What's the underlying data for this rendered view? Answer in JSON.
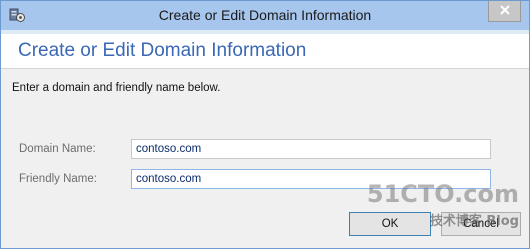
{
  "window": {
    "title": "Create or Edit Domain Information",
    "app_icon": "server-manager-icon",
    "close_icon": "close-icon"
  },
  "header": {
    "title": "Create or Edit Domain Information"
  },
  "content": {
    "instruction": "Enter a domain and friendly name below.",
    "domain_name": {
      "label": "Domain Name:",
      "value": "contoso.com"
    },
    "friendly_name": {
      "label": "Friendly Name:",
      "value": "contoso.com"
    }
  },
  "buttons": {
    "ok_label": "OK",
    "cancel_label": "Cancel"
  },
  "watermark": {
    "site": "51CTO.com",
    "tagline": "技术博客 Blog"
  }
}
